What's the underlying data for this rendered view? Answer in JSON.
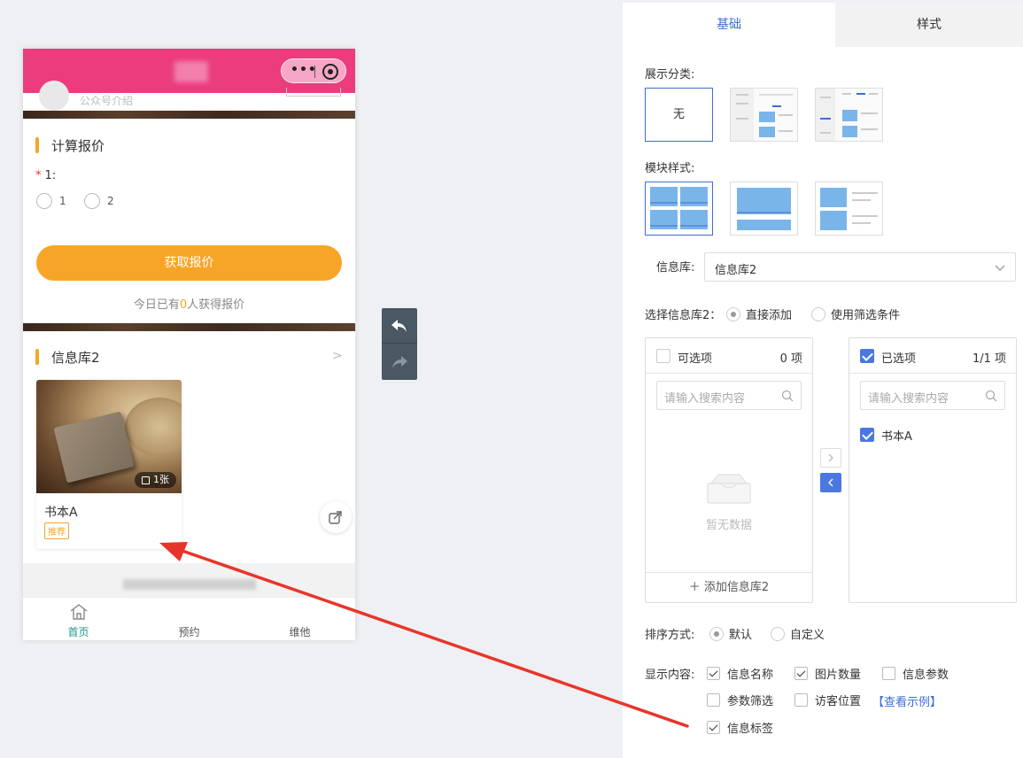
{
  "preview": {
    "partial_text": "公众号介绍",
    "section1_title": "计算报价",
    "field_label": "1:",
    "required_mark": "*",
    "radio_options": [
      "1",
      "2"
    ],
    "quote_button": "获取报价",
    "quote_note_pre": "今日已有",
    "quote_note_num": "0",
    "quote_note_post": "人获得报价",
    "section2_title": "信息库2",
    "card": {
      "name": "书本A",
      "tag": "推荐",
      "image_count": "1张"
    },
    "tabbar": [
      "首页",
      "预约",
      "维他"
    ],
    "colors": {
      "header": "#eb3c7e",
      "accent": "#f7a529",
      "active_tab": "#1b9a8a"
    }
  },
  "panel": {
    "tabs": {
      "base": "基础",
      "style": "样式"
    },
    "display_category_label": "展示分类:",
    "display_category_none": "无",
    "module_style_label": "模块样式:",
    "library_label": "信息库:",
    "library_value": "信息库2",
    "select_label": "选择信息库2：",
    "select_options": {
      "direct": "直接添加",
      "filter": "使用筛选条件"
    },
    "transfer_left": {
      "title": "可选项",
      "count": "0 项",
      "search_placeholder": "请输入搜索内容",
      "empty": "暂无数据",
      "add": "添加信息库2"
    },
    "transfer_right": {
      "title": "已选项",
      "count": "1/1 项",
      "search_placeholder": "请输入搜索内容",
      "items": [
        "书本A"
      ]
    },
    "sort_label": "排序方式:",
    "sort_options": {
      "default": "默认",
      "custom": "自定义"
    },
    "display_content_label": "显示内容:",
    "display_content": {
      "name": "信息名称",
      "image_count": "图片数量",
      "params": "信息参数",
      "param_filter": "参数筛选",
      "visitor_location": "访客位置",
      "tag": "信息标签"
    },
    "example_link": "【查看示例】",
    "colors": {
      "primary": "#3c6ed2",
      "check": "#4a78e0"
    }
  }
}
